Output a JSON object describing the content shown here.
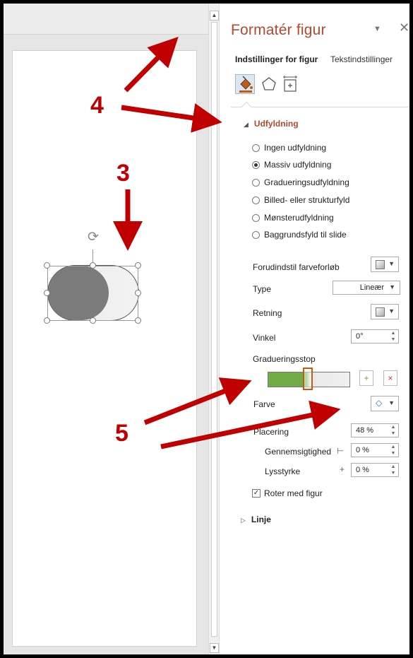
{
  "pane": {
    "title": "Formatér figur",
    "tabs": {
      "shape_options": "Indstillinger for figur",
      "text_options": "Tekstindstillinger"
    },
    "icon_tabs": [
      "paint-bucket-icon",
      "pentagon-effects-icon",
      "size-properties-icon"
    ]
  },
  "fill": {
    "section": "Udfyldning",
    "options": [
      {
        "label": "Ingen udfyldning",
        "checked": false
      },
      {
        "label": "Massiv udfyldning",
        "checked": true
      },
      {
        "label": "Gradueringsudfyldning",
        "checked": false
      },
      {
        "label": "Billed- eller strukturfyld",
        "checked": false
      },
      {
        "label": "Mønsterudfyldning",
        "checked": false
      },
      {
        "label": "Baggrundsfyld til slide",
        "checked": false
      }
    ],
    "preset_label": "Forudindstil farveforløb",
    "type_label": "Type",
    "type_value": "Lineær",
    "direction_label": "Retning",
    "angle_label": "Vinkel",
    "angle_value": "0°",
    "stops_label": "Gradueringsstop",
    "color_label": "Farve",
    "position_label": "Placering",
    "position_value": "48 %",
    "transparency_label": "Gennemsigtighed",
    "transparency_value": "0 %",
    "brightness_label": "Lysstyrke",
    "brightness_value": "0 %",
    "rotate_label": "Roter med figur",
    "rotate_checked": true
  },
  "line": {
    "section": "Linje"
  },
  "callouts": {
    "c3": "3",
    "c4": "4",
    "c5": "5"
  },
  "colors": {
    "accent": "#b7472a",
    "arrow": "#c00000",
    "gradient_green": "#70ad47"
  }
}
